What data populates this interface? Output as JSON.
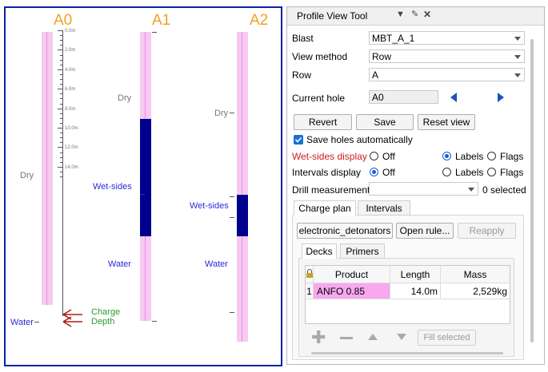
{
  "canvas": {
    "holes": [
      {
        "name": "A0"
      },
      {
        "name": "A1"
      },
      {
        "name": "A2"
      }
    ],
    "depth_ticks": [
      "0.0m",
      "2.0m",
      "4.0m",
      "6.0m",
      "8.0m",
      "10.0m",
      "12.0m",
      "14.0m"
    ],
    "labels": {
      "a0_dry": "Dry",
      "a1_dry": "Dry",
      "a2_dry": "Dry",
      "a1_wet": "Wet-sides",
      "a2_wet": "Wet-sides",
      "a1_water": "Water",
      "a2_water": "Water",
      "a0_water": "Water",
      "charge_line1": "Charge",
      "charge_line2": "Depth"
    },
    "colors": {
      "hole_label": "#f0a21e",
      "frame": "#0b22a8",
      "wet": "#00008f",
      "pink": "#f6c9f0"
    }
  },
  "panel": {
    "title": "Profile View Tool",
    "title_icons": [
      "dropdown-icon",
      "pin-icon",
      "close-icon"
    ],
    "blast_label": "Blast",
    "blast_value": "MBT_A_1",
    "view_method_label": "View method",
    "view_method_value": "Row",
    "row_label": "Row",
    "row_value": "A",
    "current_hole_label": "Current hole",
    "current_hole_value": "A0",
    "revert": "Revert",
    "save": "Save",
    "reset_view": "Reset view",
    "save_auto": "Save holes automatically",
    "wet_sides_label": "Wet-sides display",
    "intervals_label": "Intervals display",
    "off": "Off",
    "labels": "Labels",
    "flags": "Flags",
    "drill_label": "Drill measurements",
    "drill_selected": "0 selected",
    "tab_charge": "Charge plan",
    "tab_intervals": "Intervals",
    "rule_value": "electronic_detonators",
    "open_rule": "Open rule...",
    "reapply": "Reapply",
    "subtab_decks": "Decks",
    "subtab_primers": "Primers",
    "table": {
      "headers": [
        "Product",
        "Length",
        "Mass"
      ],
      "rows": [
        {
          "index": "1",
          "product": "ANFO 0.85",
          "length": "14.0m",
          "mass": "2,529kg"
        }
      ]
    },
    "fill_selected": "Fill selected",
    "colors": {
      "wet_label": "#d01c1c",
      "selected_row": "#f7a8ef"
    }
  }
}
